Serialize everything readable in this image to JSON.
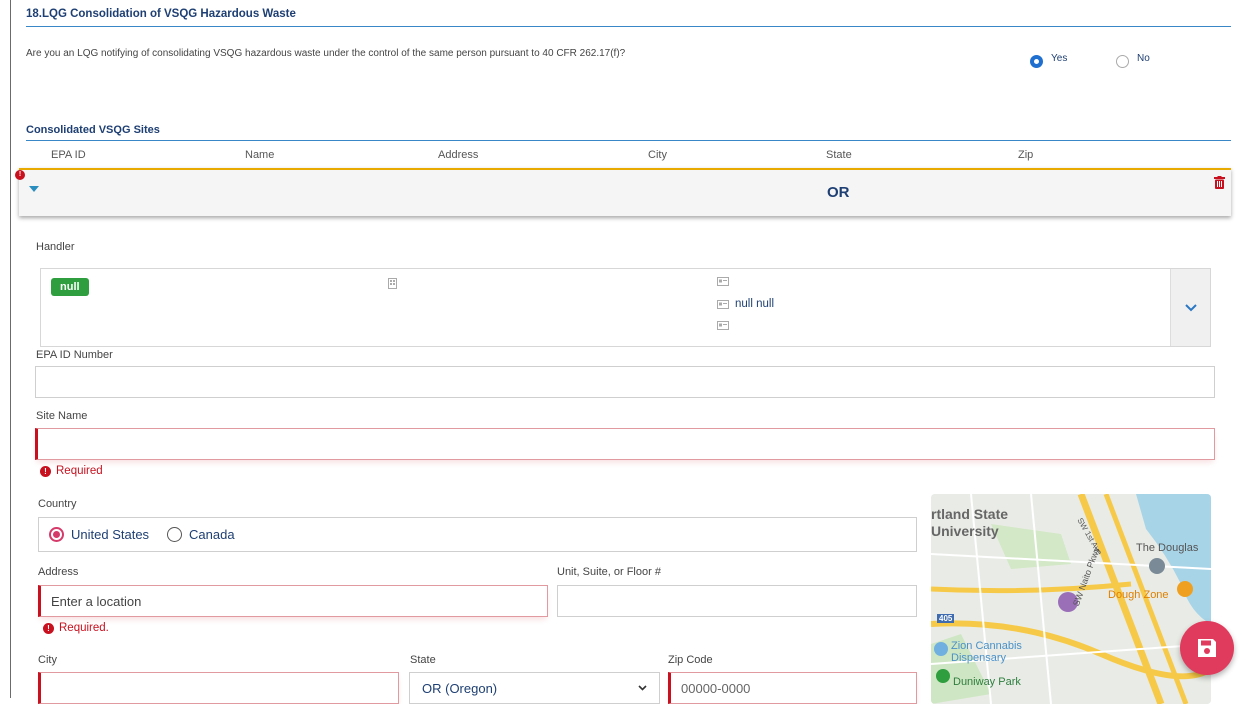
{
  "section": {
    "title": "18.LQG Consolidation of VSQG Hazardous Waste",
    "question": "Are you an LQG notifying of consolidating VSQG hazardous waste under the control of the same person pursuant to 40 CFR 262.17(f)?",
    "yes_label": "Yes",
    "no_label": "No",
    "selected": "Yes"
  },
  "sites": {
    "title": "Consolidated VSQG Sites",
    "columns": [
      "EPA ID",
      "Name",
      "Address",
      "City",
      "State",
      "Zip"
    ],
    "row": {
      "state": "OR"
    }
  },
  "handler": {
    "label": "Handler",
    "badge": "null",
    "contact_name": "null null"
  },
  "form": {
    "epa_id_label": "EPA ID Number",
    "site_name_label": "Site Name",
    "site_name_error": "Required",
    "country_label": "Country",
    "country_options": [
      "United States",
      "Canada"
    ],
    "country_selected": "United States",
    "address_label": "Address",
    "address_placeholder": "Enter a location",
    "address_error": "Required.",
    "unit_label": "Unit, Suite, or Floor #",
    "city_label": "City",
    "state_label": "State",
    "state_value": "OR (Oregon)",
    "zip_label": "Zip Code",
    "zip_placeholder": "00000-0000"
  },
  "map": {
    "labels": [
      "rtland State",
      "University",
      "The Douglas",
      "Dough Zone",
      "Zion Cannabis",
      "Dispensary",
      "Duniway Park",
      "SW 1st Ave",
      "SW Naito Pkwy",
      "405"
    ]
  },
  "colors": {
    "primary": "#1e3f73",
    "accent_line": "#3a87c8",
    "row_top": "#e8a900",
    "error": "#c8101e",
    "radio_pink": "#d63a6a",
    "save_button": "#e03a5c",
    "badge_green": "#2e9e3e"
  }
}
